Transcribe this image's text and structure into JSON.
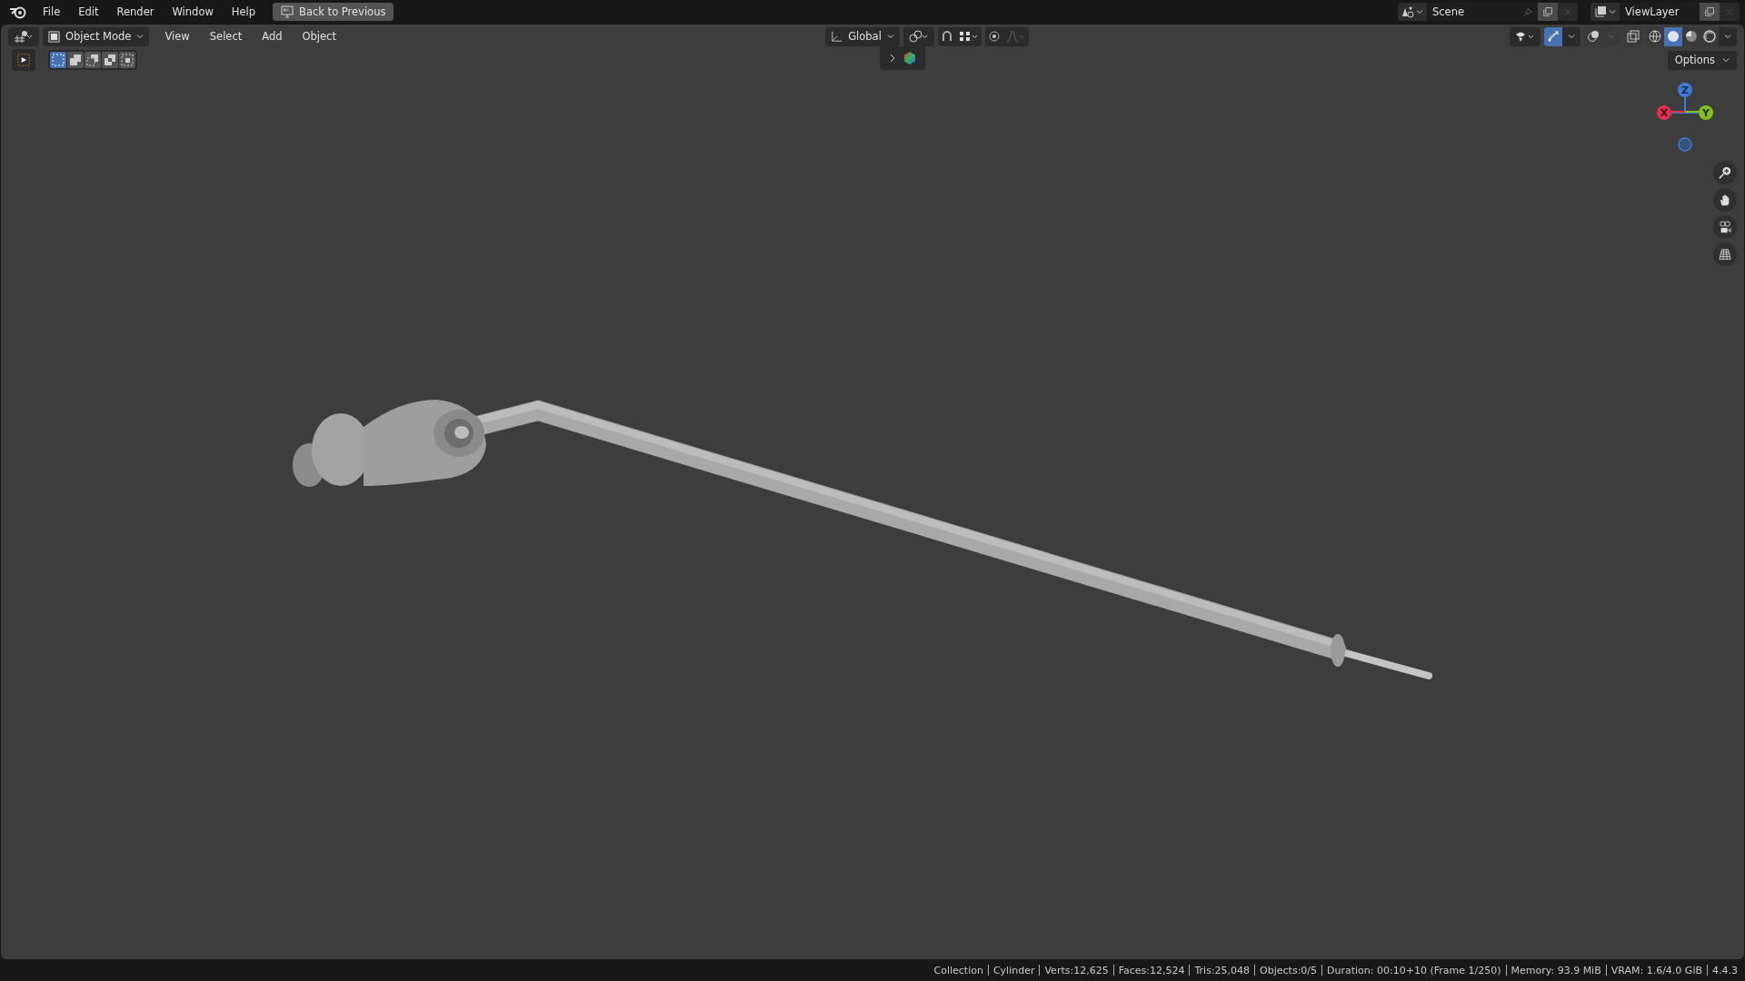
{
  "top_bar": {
    "menus": [
      "File",
      "Edit",
      "Render",
      "Window",
      "Help"
    ],
    "back_button": "Back to Previous",
    "scene": "Scene",
    "view_layer": "ViewLayer"
  },
  "header": {
    "mode": "Object Mode",
    "menus": [
      "View",
      "Select",
      "Add",
      "Object"
    ],
    "orientation": "Global",
    "snap_on": false,
    "proportional_on": false,
    "gizmos_on": true,
    "shading": [
      {
        "kind": "wireframe",
        "selected": false
      },
      {
        "kind": "solid",
        "selected": true
      },
      {
        "kind": "material",
        "selected": false
      },
      {
        "kind": "rendered",
        "selected": false
      }
    ]
  },
  "tool_settings": {
    "select_modes": [
      {
        "kind": "new",
        "selected": true
      },
      {
        "kind": "extend",
        "selected": false
      },
      {
        "kind": "subtract",
        "selected": false
      },
      {
        "kind": "invert",
        "selected": false
      },
      {
        "kind": "intersect",
        "selected": false
      }
    ],
    "options": "Options"
  },
  "gizmo": {
    "axes": [
      "X",
      "Y",
      "Z"
    ]
  },
  "status_bar": [
    "Collection",
    "Cylinder",
    "Verts:12,625",
    "Faces:12,524",
    "Tris:25,048",
    "Objects:0/5",
    "Duration: 00:10+10 (Frame 1/250)",
    "Memory: 93.9 MiB",
    "VRAM: 1.6/4.0 GiB",
    "4.4.3"
  ]
}
